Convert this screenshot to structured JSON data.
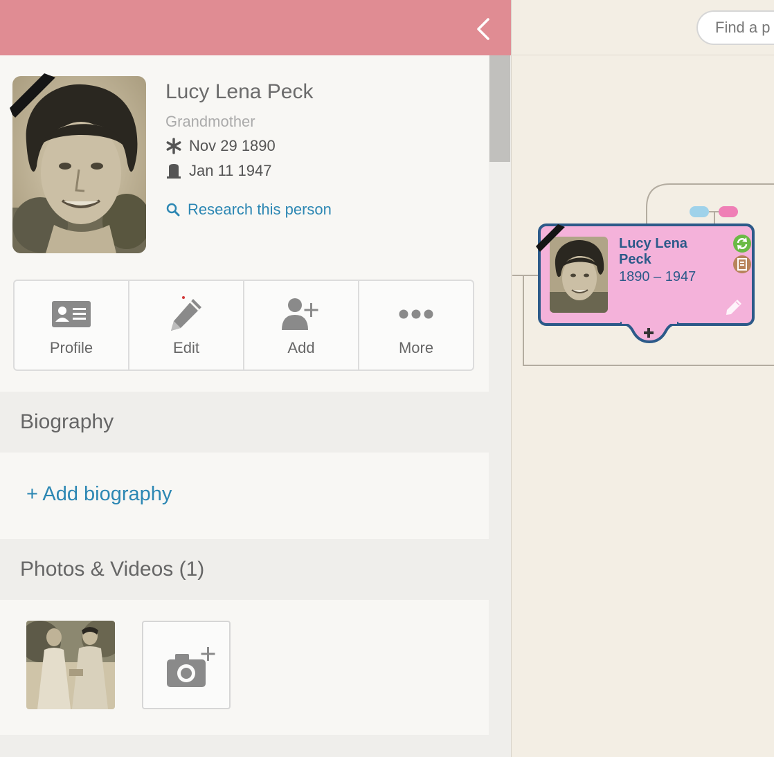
{
  "person": {
    "name": "Lucy Lena Peck",
    "relation": "Grandmother",
    "birth": "Nov 29 1890",
    "death": "Jan 11 1947",
    "research_link": "Research this person"
  },
  "actions": [
    {
      "label": "Profile",
      "icon": "profile-card-icon"
    },
    {
      "label": "Edit",
      "icon": "pencil-icon"
    },
    {
      "label": "Add",
      "icon": "add-person-icon"
    },
    {
      "label": "More",
      "icon": "more-dots-icon"
    }
  ],
  "sections": {
    "biography": {
      "title": "Biography",
      "add_label": "+ Add biography"
    },
    "photos": {
      "title": "Photos & Videos (1)"
    }
  },
  "tree": {
    "search_placeholder": "Find a p",
    "card": {
      "name": "Lucy Lena Peck",
      "dates": "1890 – 1947"
    }
  },
  "colors": {
    "header": "#e08c93",
    "link": "#2c87b3",
    "card_fill": "#f4b2da",
    "card_border": "#2c5a89",
    "male": "#9fd2ea",
    "female": "#ef7fb6"
  }
}
